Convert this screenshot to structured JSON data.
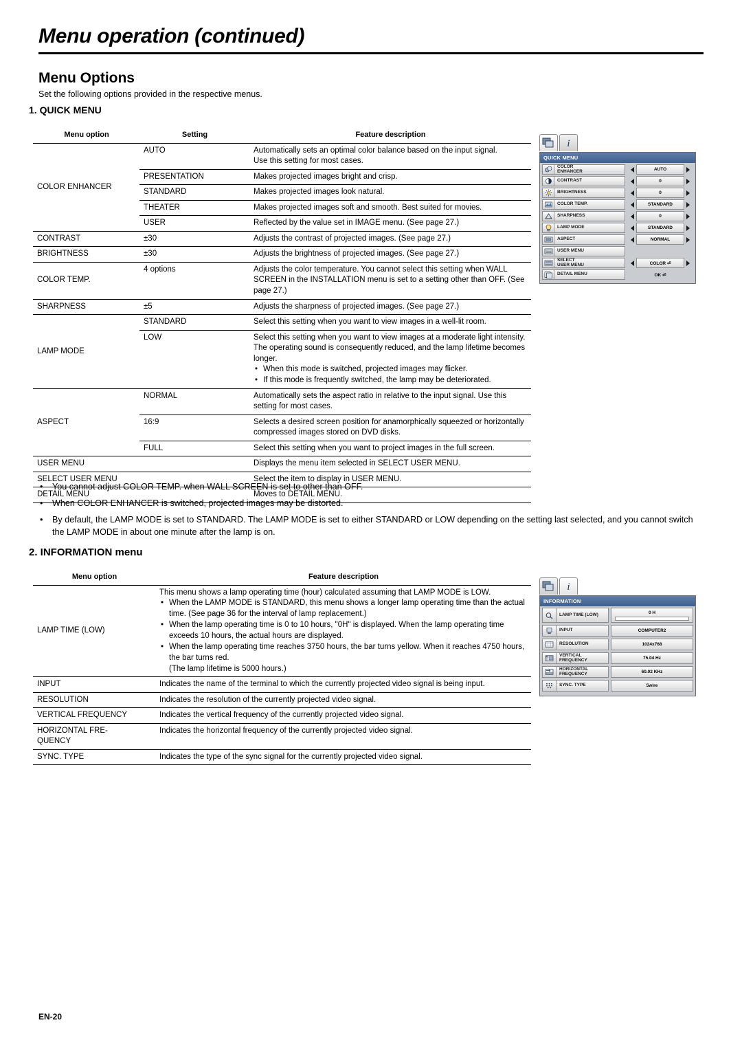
{
  "page": {
    "title": "Menu operation (continued)",
    "section_title": "Menu Options",
    "section_sub": "Set the following options provided in the respective menus.",
    "quick_heading": "1. QUICK MENU",
    "info_heading": "2. INFORMATION menu",
    "footer": "EN-20"
  },
  "quick_table": {
    "headers": [
      "Menu option",
      "Setting",
      "Feature description"
    ],
    "rows": [
      {
        "option": "COLOR ENHANCER",
        "settings": [
          {
            "setting": "AUTO",
            "desc": "Automatically sets an optimal color balance based on the input signal.\nUse this setting for most cases."
          },
          {
            "setting": "PRESENTATION",
            "desc": "Makes projected images bright and crisp."
          },
          {
            "setting": "STANDARD",
            "desc": "Makes projected images look natural."
          },
          {
            "setting": "THEATER",
            "desc": "Makes projected images soft and smooth. Best suited for movies."
          },
          {
            "setting": "USER",
            "desc": "Reflected by the value set in IMAGE menu. (See page 27.)"
          }
        ]
      },
      {
        "option": "CONTRAST",
        "settings": [
          {
            "setting": "±30",
            "desc": "Adjusts the contrast of projected images. (See page 27.)"
          }
        ]
      },
      {
        "option": "BRIGHTNESS",
        "settings": [
          {
            "setting": "±30",
            "desc": "Adjusts the brightness of projected images. (See page 27.)"
          }
        ]
      },
      {
        "option": "COLOR TEMP.",
        "settings": [
          {
            "setting": "4 options",
            "desc": "Adjusts the color temperature. You cannot select this setting when WALL SCREEN in the INSTALLATION menu is set to a setting other than OFF. (See page 27.)"
          }
        ]
      },
      {
        "option": "SHARPNESS",
        "settings": [
          {
            "setting": "±5",
            "desc": "Adjusts the sharpness of projected images. (See page 27.)"
          }
        ]
      },
      {
        "option": "LAMP MODE",
        "settings": [
          {
            "setting": "STANDARD",
            "desc": "Select this setting when you want to view images in a well-lit room."
          },
          {
            "setting": "LOW",
            "desc": "Select this setting when you want to view images at a moderate light intensity. The operating sound is consequently reduced, and the lamp lifetime becomes longer.",
            "bullets": [
              "When this mode is switched, projected images may flicker.",
              "If this mode is frequently switched, the lamp may be deteriorated."
            ]
          }
        ]
      },
      {
        "option": "ASPECT",
        "settings": [
          {
            "setting": "NORMAL",
            "desc": "Automatically sets the aspect ratio in relative to the input signal. Use this setting for most cases."
          },
          {
            "setting": "16:9",
            "desc": "Selects a desired screen position for anamorphically squeezed or horizontally compressed images stored on DVD disks."
          },
          {
            "setting": "FULL",
            "desc": "Select this setting when you want to project images in the full screen."
          }
        ]
      },
      {
        "option": "USER MENU",
        "settings": [
          {
            "setting": "",
            "desc": "Displays the menu item selected in SELECT USER MENU."
          }
        ]
      },
      {
        "option": "SELECT USER MENU",
        "settings": [
          {
            "setting": "",
            "desc": "Select the item to display in USER MENU."
          }
        ]
      },
      {
        "option": "DETAIL MENU",
        "settings": [
          {
            "setting": "",
            "desc": "Moves to DETAIL MENU."
          }
        ]
      }
    ]
  },
  "notes": [
    "You cannot adjust COLOR TEMP. when WALL SCREEN is set to other than OFF.",
    "When COLOR ENHANCER is switched, projected images may be distorted.",
    "By default, the LAMP MODE is set to STANDARD. The LAMP MODE is set to either STANDARD or LOW depending on the setting last selected, and you cannot switch the LAMP MODE in about one minute after the lamp is on."
  ],
  "info_table": {
    "headers": [
      "Menu option",
      "Feature description"
    ],
    "rows": [
      {
        "option": "LAMP TIME (LOW)",
        "desc": "This menu shows a lamp operating time (hour) calculated assuming that LAMP MODE is LOW.",
        "bullets": [
          "When the LAMP MODE is STANDARD, this menu shows a longer lamp operating time than the actual time. (See page 36 for the interval of lamp replacement.)",
          "When the lamp operating time is 0 to 10 hours, \"0H\" is displayed. When the lamp operating time exceeds 10 hours, the actual hours are displayed.",
          "When the lamp operating time reaches 3750 hours, the bar turns yellow. When it reaches 4750 hours, the bar turns red."
        ],
        "tail": "(The lamp lifetime is 5000 hours.)"
      },
      {
        "option": "INPUT",
        "desc": "Indicates the name of the terminal to which the currently projected video signal is being input."
      },
      {
        "option": "RESOLUTION",
        "desc": "Indicates the resolution of the currently projected video signal."
      },
      {
        "option": "VERTICAL FREQUENCY",
        "desc": "Indicates the vertical frequency of the currently projected video signal."
      },
      {
        "option": "HORIZONTAL FRE-\nQUENCY",
        "desc": "Indicates the horizontal frequency of the currently projected video signal."
      },
      {
        "option": "SYNC. TYPE",
        "desc": "Indicates the type of the sync signal for the currently projected video signal."
      }
    ]
  },
  "osd_quick": {
    "header": "QUICK MENU",
    "rows": [
      {
        "icon": "color-enhancer-icon",
        "label": "COLOR\nENHANCER",
        "value": "AUTO",
        "arrows": true
      },
      {
        "icon": "contrast-icon",
        "label": "CONTRAST",
        "value": "0",
        "arrows": true
      },
      {
        "icon": "brightness-icon",
        "label": "BRIGHTNESS",
        "value": "0",
        "arrows": true
      },
      {
        "icon": "color-temp-icon",
        "label": "COLOR TEMP.",
        "value": "STANDARD",
        "arrows": true
      },
      {
        "icon": "sharpness-icon",
        "label": "SHARPNESS",
        "value": "0",
        "arrows": true
      },
      {
        "icon": "lamp-mode-icon",
        "label": "LAMP MODE",
        "value": "STANDARD",
        "arrows": true
      },
      {
        "icon": "aspect-icon",
        "label": "ASPECT",
        "value": "NORMAL",
        "arrows": true
      },
      {
        "icon": "user-menu-icon",
        "label": "USER MENU",
        "value": "",
        "arrows": false
      },
      {
        "icon": "select-user-menu-icon",
        "label": "SELECT\nUSER MENU",
        "value": "COLOR ⏎",
        "arrows": true
      },
      {
        "icon": "detail-menu-icon",
        "label": "DETAIL MENU",
        "value": "OK ⏎",
        "arrows": false
      }
    ]
  },
  "osd_info": {
    "header": "INFORMATION",
    "rows": [
      {
        "icon": "lamp-time-icon",
        "label": "LAMP TIME (LOW)",
        "value": "0 H",
        "bar": true
      },
      {
        "icon": "input-icon",
        "label": "INPUT",
        "value": "COMPUTER2"
      },
      {
        "icon": "resolution-icon",
        "label": "RESOLUTION",
        "value": "1024x768"
      },
      {
        "icon": "vertical-frequency-icon",
        "label": "VERTICAL\nFREQUENCY",
        "value": "75.04 Hz"
      },
      {
        "icon": "horizontal-frequency-icon",
        "label": "HORIZONTAL\nFREQUENCY",
        "value": "60.02 KHz"
      },
      {
        "icon": "sync-type-icon",
        "label": "SYNC. TYPE",
        "value": "5wire"
      }
    ]
  }
}
